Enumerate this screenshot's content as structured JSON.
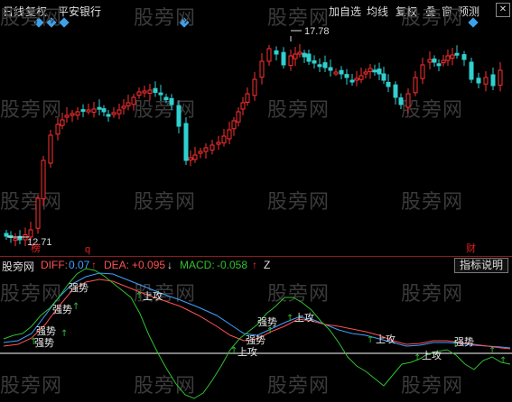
{
  "toolbar": {
    "period": "日线",
    "adjust": "复权",
    "stock_name": "平安银行",
    "buttons": [
      "加自选",
      "均线",
      "复权",
      "叠",
      "窗",
      "预测"
    ],
    "close": "✕"
  },
  "watermark": "股旁网",
  "price_chart": {
    "high_label": "17.78",
    "low_label": "12.71",
    "markers": [
      "榜",
      "q",
      "财"
    ]
  },
  "indicator": {
    "source": "股旁网",
    "diff_label": "DIFF:",
    "diff_value": "0.07",
    "dea_label": "DEA:",
    "dea_value": "+0.095",
    "macd_label": "MACD:",
    "macd_value": "-0.058",
    "extra": "Z",
    "help_button": "指标说明",
    "signals": [
      "强势",
      "上攻"
    ]
  },
  "colors": {
    "up": "#ff3030",
    "down": "#30d0d0",
    "diff": "#ff5050",
    "dea": "#40a0ff",
    "macd": "#30c030"
  }
}
